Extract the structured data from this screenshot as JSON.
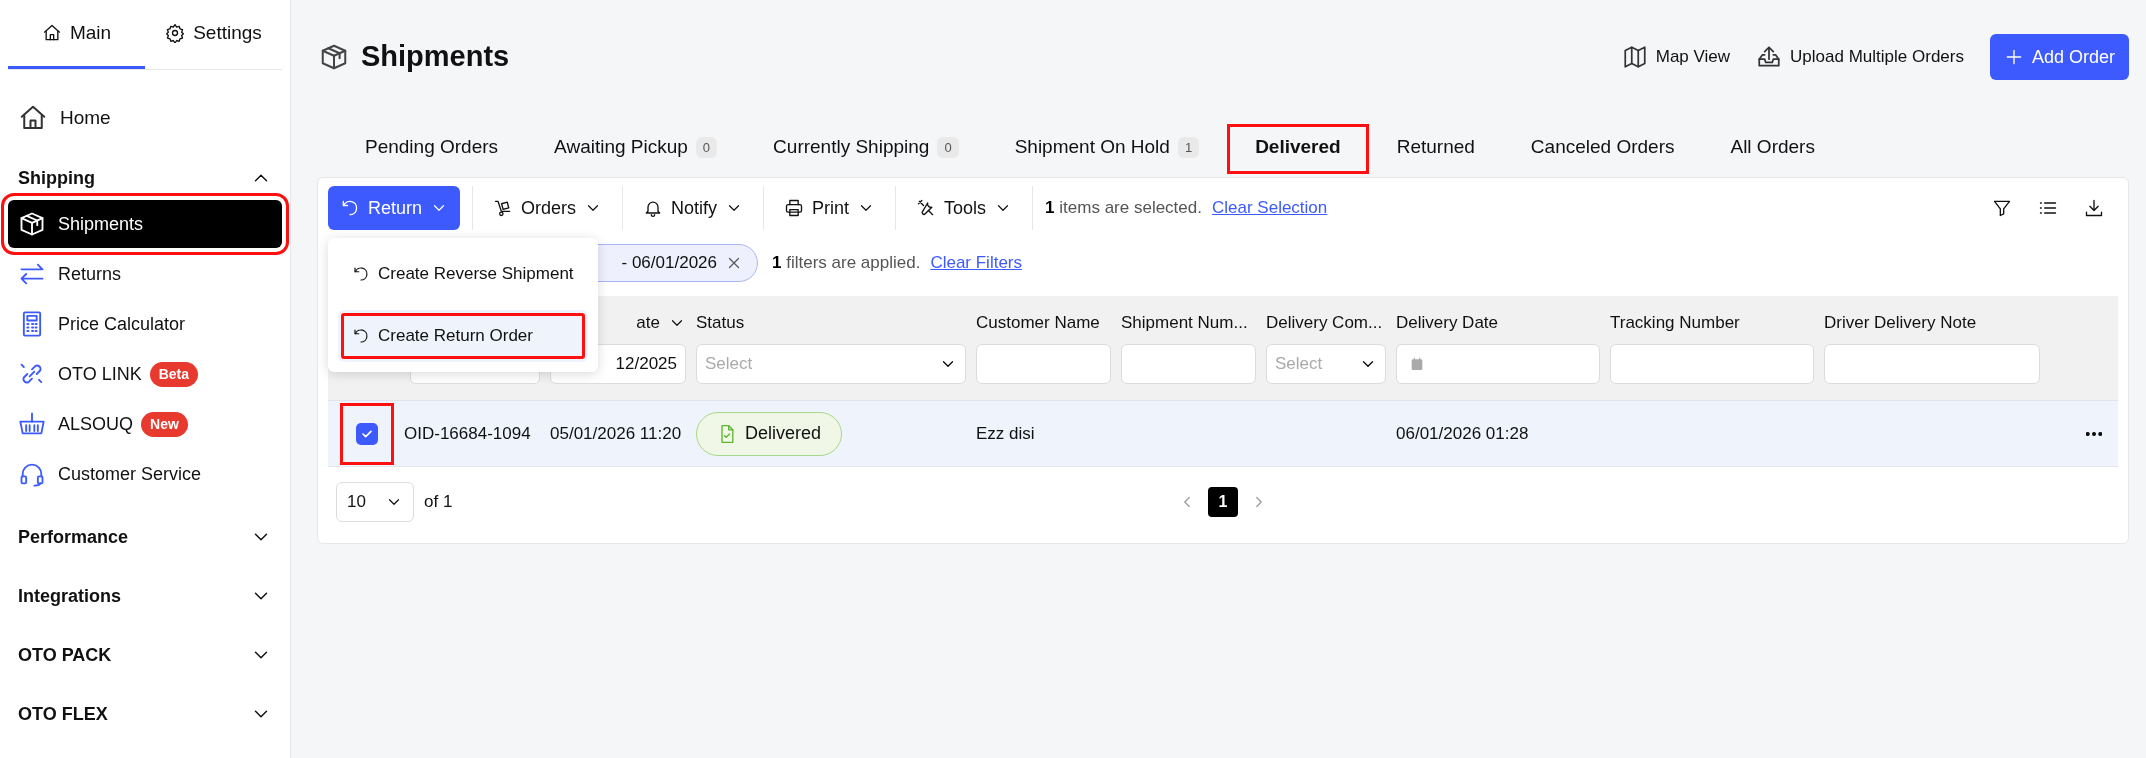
{
  "sidebar": {
    "tabs": [
      {
        "label": "Main",
        "selected": true
      },
      {
        "label": "Settings",
        "selected": false
      }
    ],
    "home": {
      "label": "Home"
    },
    "sections": [
      {
        "title": "Shipping",
        "expanded": true,
        "items": [
          {
            "label": "Shipments",
            "selected": true,
            "highlighted": true
          },
          {
            "label": "Returns",
            "selected": false,
            "highlighted": false
          },
          {
            "label": "Price Calculator",
            "selected": false,
            "highlighted": false
          },
          {
            "label": "OTO LINK",
            "badge": "Beta",
            "selected": false,
            "highlighted": false
          },
          {
            "label": "ALSOUQ",
            "badge": "New",
            "selected": false,
            "highlighted": false
          },
          {
            "label": "Customer Service",
            "selected": false,
            "highlighted": false
          }
        ]
      },
      {
        "title": "Performance",
        "expanded": false
      },
      {
        "title": "Integrations",
        "expanded": false
      },
      {
        "title": "OTO PACK",
        "expanded": false
      },
      {
        "title": "OTO FLEX",
        "expanded": false
      }
    ]
  },
  "header": {
    "title": "Shipments",
    "actions": [
      {
        "kind": "link",
        "label": "Map View"
      },
      {
        "kind": "link",
        "label": "Upload Multiple Orders"
      },
      {
        "kind": "primary",
        "label": "Add Order"
      }
    ]
  },
  "tabs": [
    {
      "label": "Pending Orders",
      "selected": false,
      "highlighted": false
    },
    {
      "label": "Awaiting Pickup",
      "count": "0",
      "selected": false,
      "highlighted": false
    },
    {
      "label": "Currently Shipping",
      "count": "0",
      "selected": false,
      "highlighted": false
    },
    {
      "label": "Shipment On Hold",
      "count": "1",
      "selected": false,
      "highlighted": false
    },
    {
      "label": "Delivered",
      "selected": true,
      "highlighted": true
    },
    {
      "label": "Returned",
      "selected": false,
      "highlighted": false
    },
    {
      "label": "Canceled Orders",
      "selected": false,
      "highlighted": false
    },
    {
      "label": "All Orders",
      "selected": false,
      "highlighted": false
    }
  ],
  "toolbar": {
    "buttons": [
      {
        "kind": "primary",
        "label": "Return"
      },
      {
        "kind": "plain",
        "label": "Orders"
      },
      {
        "kind": "plain",
        "label": "Notify"
      },
      {
        "kind": "plain",
        "label": "Print"
      },
      {
        "kind": "plain",
        "label": "Tools"
      }
    ],
    "selection_text": "**1** items are selected.",
    "clear_selection": "Clear Selection"
  },
  "return_menu": {
    "items": [
      {
        "label": "Create Reverse Shipment",
        "selected": false,
        "highlighted": false
      },
      {
        "label": "Create Return Order",
        "selected": true,
        "highlighted": true
      }
    ]
  },
  "filters": {
    "chip": "- 06/01/2026",
    "summary": "**1** filters are applied.",
    "clear_filters": "Clear Filters"
  },
  "table": {
    "columns": [
      {
        "filter": {
          "kind": "text"
        }
      },
      {
        "label": "ate",
        "sortable": true,
        "filter": {
          "kind": "text",
          "value": "12/2025"
        }
      },
      {
        "label": "Status",
        "filter": {
          "kind": "select",
          "placeholder": "Select"
        }
      },
      {
        "label": "Customer Name",
        "filter": {
          "kind": "text"
        }
      },
      {
        "label": "Shipment Num...",
        "filter": {
          "kind": "text"
        }
      },
      {
        "label": "Delivery Com...",
        "filter": {
          "kind": "select",
          "placeholder": "Select"
        }
      },
      {
        "label": "Delivery Date",
        "filter": {
          "kind": "date"
        }
      },
      {
        "label": "Tracking Number",
        "filter": {
          "kind": "text"
        }
      },
      {
        "label": "Driver Delivery Note",
        "filter": {
          "kind": "text"
        }
      }
    ],
    "rows": [
      {
        "selected": true,
        "highlighted": true,
        "order_id": "OID-16684-1094",
        "date": "05/01/2026 11:20",
        "status": "Delivered",
        "customer_name": "Ezz disi",
        "delivery_date": "06/01/2026 01:28"
      }
    ]
  },
  "pagination": {
    "page_size": "10",
    "of_text": "of 1",
    "pages": [
      {
        "label": "1",
        "selected": true
      }
    ]
  }
}
